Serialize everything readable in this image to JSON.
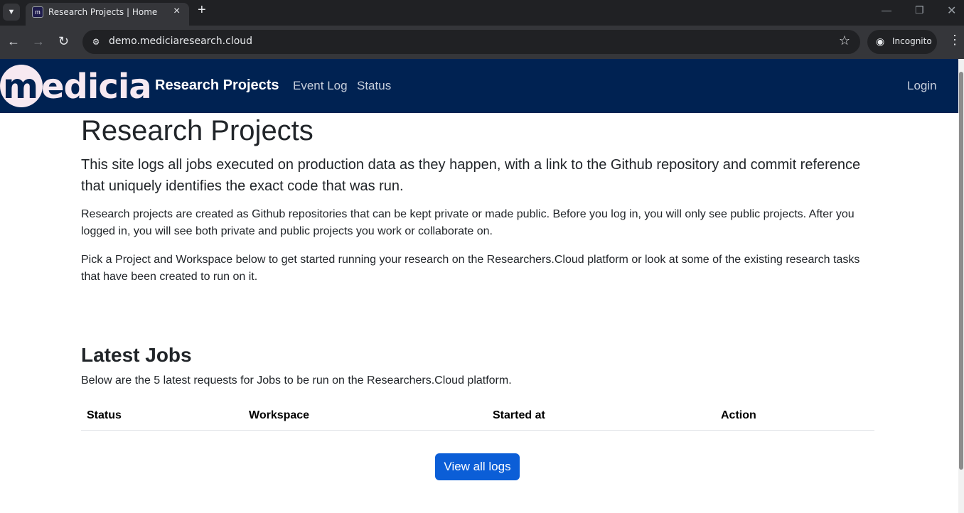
{
  "browser": {
    "tab_title": "Research Projects | Home",
    "favicon_letter": "m",
    "url": "demo.mediciaresearch.cloud",
    "incognito_label": "Incognito"
  },
  "navbar": {
    "logo_first": "m",
    "logo_rest": "edicia",
    "brand": "Research Projects",
    "links": [
      "Event Log",
      "Status"
    ],
    "login": "Login"
  },
  "main": {
    "title": "Research Projects",
    "lead": "This site logs all jobs executed on production data as they happen, with a link to the Github repository and commit reference that uniquely identifies the exact code that was run.",
    "para1": "Research projects are created as Github repositories that can be kept private or made public. Before you log in, you will only see public projects. After you logged in, you will see both private and public projects you work or collaborate on.",
    "para2": "Pick a Project and Workspace below to get started running your research on the Researchers.Cloud platform or look at some of the existing research tasks that have been created to run on it."
  },
  "jobs": {
    "title": "Latest Jobs",
    "subtitle": "Below are the 5 latest requests for Jobs to be run on the Researchers.Cloud platform.",
    "columns": [
      "Status",
      "Workspace",
      "Started at",
      "Action"
    ],
    "button": "View all logs"
  }
}
